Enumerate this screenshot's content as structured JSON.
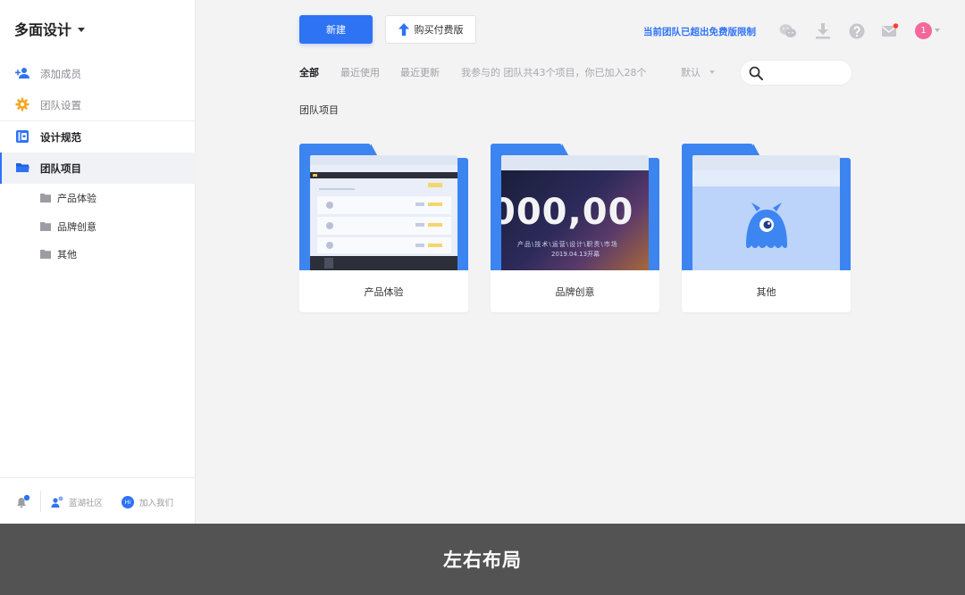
{
  "sidebar": {
    "team_name": "多面设计",
    "menu": [
      {
        "label": "添加成员"
      },
      {
        "label": "团队设置"
      },
      {
        "label": "设计规范"
      },
      {
        "label": "团队项目"
      }
    ],
    "folders": [
      {
        "label": "产品体验"
      },
      {
        "label": "品牌创意"
      },
      {
        "label": "其他"
      }
    ],
    "footer": {
      "community_label": "蓝湖社区",
      "join_label": "加入我们",
      "join_icon_text": "Hi"
    }
  },
  "toolbar": {
    "new_label": "新建",
    "upgrade_label": "购买付费版",
    "limit_text": "当前团队已超出免费版限制",
    "avatar_text": "1"
  },
  "filters": {
    "tabs": [
      {
        "label": "全部"
      },
      {
        "label": "最近使用"
      },
      {
        "label": "最近更新"
      }
    ],
    "summary": "我参与的 团队共43个项目，你已加入28个",
    "sort_label": "默认"
  },
  "section_title": "团队项目",
  "projects": [
    {
      "name": "产品体验"
    },
    {
      "name": "品牌创意",
      "thumb_big": "000,00",
      "thumb_sub": "产品\\技术\\运营\\设计\\职责\\市场",
      "thumb_date": "2019.04.13开幕"
    },
    {
      "name": "其他"
    }
  ],
  "banner": {
    "text": "左右布局"
  },
  "colors": {
    "accent": "#2f73f5",
    "folder": "#3c85f1",
    "banner": "#535353",
    "avatar": "#f4679a",
    "mail_dot": "#ff3b30"
  }
}
